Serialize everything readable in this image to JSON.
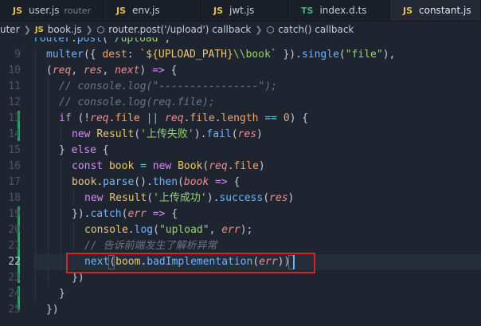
{
  "tabs": [
    {
      "badge": "JS",
      "badge_color": "#e6c14a",
      "label": "user.js",
      "desc": "router",
      "active": false
    },
    {
      "badge": "JS",
      "badge_color": "#e6c14a",
      "label": "env.js",
      "desc": "",
      "active": false
    },
    {
      "badge": "JS",
      "badge_color": "#e6c14a",
      "label": "jwt.js",
      "desc": "",
      "active": false
    },
    {
      "badge": "TS",
      "badge_color": "#3fb37f",
      "label": "index.d.ts",
      "desc": "",
      "active": false
    },
    {
      "badge": "JS",
      "badge_color": "#e6c14a",
      "label": "constant.js",
      "desc": "",
      "active": true
    }
  ],
  "breadcrumb": {
    "folder": "uter",
    "file_badge": "JS",
    "file": "book.js",
    "symbol1": "router.post('/upload') callback",
    "symbol2": "catch() callback"
  },
  "line_numbers": [
    "",
    "9",
    "10",
    "11",
    "12",
    "13",
    "14",
    "15",
    "16",
    "17",
    "18",
    "19",
    "20",
    "21",
    "22",
    "23",
    "24",
    "25"
  ],
  "active_line": "22",
  "code_lines": [
    {
      "indent": 0,
      "tokens": [
        [
          "tk-fn",
          "router"
        ],
        [
          "tk-pun",
          "."
        ],
        [
          "tk-fn",
          "post"
        ],
        [
          "tk-pun",
          "("
        ],
        [
          "tk-str",
          "'/upload'"
        ],
        [
          "tk-pun",
          ","
        ]
      ]
    },
    {
      "indent": 1,
      "tokens": [
        [
          "tk-fn",
          "multer"
        ],
        [
          "tk-pun",
          "({ "
        ],
        [
          "tk-prop",
          "dest"
        ],
        [
          "tk-pun",
          ": "
        ],
        [
          "tk-tpl",
          "`${"
        ],
        [
          "tk-cls",
          "UPLOAD_PATH"
        ],
        [
          "tk-tpl",
          "}"
        ],
        [
          "tk-str",
          "\\\\book"
        ],
        [
          "tk-tpl",
          "`"
        ],
        [
          "tk-pun",
          " })."
        ],
        [
          "tk-fn",
          "single"
        ],
        [
          "tk-pun",
          "("
        ],
        [
          "tk-str",
          "\"file\""
        ],
        [
          "tk-pun",
          "),"
        ]
      ]
    },
    {
      "indent": 1,
      "tokens": [
        [
          "tk-pun",
          "("
        ],
        [
          "tk-par",
          "req"
        ],
        [
          "tk-pun",
          ", "
        ],
        [
          "tk-par",
          "res"
        ],
        [
          "tk-pun",
          ", "
        ],
        [
          "tk-par",
          "next"
        ],
        [
          "tk-pun",
          ") "
        ],
        [
          "tk-kw",
          "=>"
        ],
        [
          "tk-pun",
          " {"
        ]
      ]
    },
    {
      "indent": 2,
      "tokens": [
        [
          "tk-com",
          "// console.log(\"----------------\");"
        ]
      ]
    },
    {
      "indent": 2,
      "tokens": [
        [
          "tk-com",
          "// console.log(req.file);"
        ]
      ]
    },
    {
      "indent": 2,
      "tokens": [
        [
          "tk-kw",
          "if"
        ],
        [
          "tk-pun",
          " (!"
        ],
        [
          "tk-par",
          "req"
        ],
        [
          "tk-pun",
          "."
        ],
        [
          "tk-prop",
          "file"
        ],
        [
          "tk-op",
          " || "
        ],
        [
          "tk-par",
          "req"
        ],
        [
          "tk-pun",
          "."
        ],
        [
          "tk-prop",
          "file"
        ],
        [
          "tk-pun",
          "."
        ],
        [
          "tk-prop",
          "length"
        ],
        [
          "tk-op",
          " == "
        ],
        [
          "tk-num",
          "0"
        ],
        [
          "tk-pun",
          ") {"
        ]
      ]
    },
    {
      "indent": 3,
      "tokens": [
        [
          "tk-kw",
          "new "
        ],
        [
          "tk-cls",
          "Result"
        ],
        [
          "tk-pun",
          "("
        ],
        [
          "tk-str",
          "'上传失败'"
        ],
        [
          "tk-pun",
          ")."
        ],
        [
          "tk-fn",
          "fail"
        ],
        [
          "tk-pun",
          "("
        ],
        [
          "tk-par",
          "res"
        ],
        [
          "tk-pun",
          ")"
        ]
      ]
    },
    {
      "indent": 2,
      "tokens": [
        [
          "tk-pun",
          "} "
        ],
        [
          "tk-kw",
          "else"
        ],
        [
          "tk-pun",
          " {"
        ]
      ]
    },
    {
      "indent": 3,
      "tokens": [
        [
          "tk-kw",
          "const "
        ],
        [
          "tk-cls",
          "book"
        ],
        [
          "tk-op",
          " = "
        ],
        [
          "tk-kw",
          "new "
        ],
        [
          "tk-cls",
          "Book"
        ],
        [
          "tk-pun",
          "("
        ],
        [
          "tk-par",
          "req"
        ],
        [
          "tk-pun",
          "."
        ],
        [
          "tk-prop",
          "file"
        ],
        [
          "tk-pun",
          ")"
        ]
      ]
    },
    {
      "indent": 3,
      "tokens": [
        [
          "tk-cls",
          "book"
        ],
        [
          "tk-pun",
          "."
        ],
        [
          "tk-fn",
          "parse"
        ],
        [
          "tk-pun",
          "()."
        ],
        [
          "tk-fn",
          "then"
        ],
        [
          "tk-pun",
          "("
        ],
        [
          "tk-par",
          "book"
        ],
        [
          "tk-kw",
          " =>"
        ],
        [
          "tk-pun",
          " {"
        ]
      ]
    },
    {
      "indent": 4,
      "tokens": [
        [
          "tk-kw",
          "new "
        ],
        [
          "tk-cls",
          "Result"
        ],
        [
          "tk-pun",
          "("
        ],
        [
          "tk-str",
          "'上传成功'"
        ],
        [
          "tk-pun",
          ")."
        ],
        [
          "tk-fn",
          "success"
        ],
        [
          "tk-pun",
          "("
        ],
        [
          "tk-par",
          "res"
        ],
        [
          "tk-pun",
          ")"
        ]
      ]
    },
    {
      "indent": 3,
      "tokens": [
        [
          "tk-pun",
          "})."
        ],
        [
          "tk-fn",
          "catch"
        ],
        [
          "tk-pun",
          "("
        ],
        [
          "tk-par",
          "err"
        ],
        [
          "tk-kw",
          " =>"
        ],
        [
          "tk-pun",
          " {"
        ]
      ]
    },
    {
      "indent": 4,
      "tokens": [
        [
          "tk-cls",
          "console"
        ],
        [
          "tk-pun",
          "."
        ],
        [
          "tk-fn",
          "log"
        ],
        [
          "tk-pun",
          "("
        ],
        [
          "tk-str",
          "\"upload\""
        ],
        [
          "tk-pun",
          ", "
        ],
        [
          "tk-par",
          "err"
        ],
        [
          "tk-pun",
          ");"
        ]
      ]
    },
    {
      "indent": 4,
      "tokens": [
        [
          "tk-com",
          "// 告诉前端发生了解析异常"
        ]
      ]
    },
    {
      "indent": 4,
      "tokens": [
        [
          "tk-fn",
          "next"
        ],
        [
          "tk-pun",
          "("
        ],
        [
          "tk-cls",
          "boom"
        ],
        [
          "tk-pun",
          "."
        ],
        [
          "tk-fn",
          "badImplementation"
        ],
        [
          "tk-pun",
          "("
        ],
        [
          "tk-par",
          "err"
        ],
        [
          "tk-pun",
          "))"
        ]
      ]
    },
    {
      "indent": 3,
      "tokens": [
        [
          "tk-pun",
          "})"
        ]
      ]
    },
    {
      "indent": 2,
      "tokens": [
        [
          "tk-pun",
          "}"
        ]
      ]
    },
    {
      "indent": 1,
      "tokens": [
        [
          "tk-pun",
          "})"
        ]
      ]
    }
  ]
}
